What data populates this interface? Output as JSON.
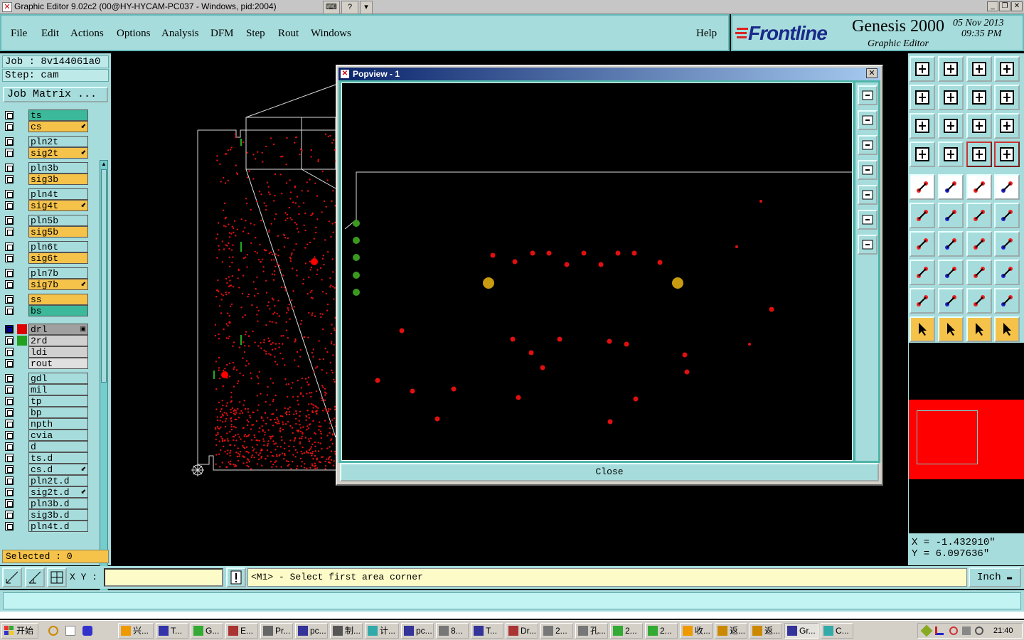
{
  "titlebar": {
    "title": "Graphic Editor 9.02c2 (00@HY-HYCAM-PC037 - Windows, pid:2004)",
    "mid_buttons": [
      "keyboard-icon",
      "help-icon",
      "menu-arrow-icon"
    ],
    "window_buttons": [
      "minimize",
      "restore",
      "close"
    ]
  },
  "menu": {
    "items": [
      "File",
      "Edit",
      "Actions",
      "Options",
      "Analysis",
      "DFM",
      "Step",
      "Rout",
      "Windows"
    ],
    "help": "Help"
  },
  "brand": {
    "logo": "Frontline",
    "product": "Genesis 2000",
    "subtitle": "Graphic Editor",
    "date": "05 Nov 2013",
    "time": "09:35 PM"
  },
  "job": {
    "job_label": "Job : 8v144061a0",
    "step_label": "Step: cam",
    "matrix_button": "Job Matrix ..."
  },
  "layers": [
    {
      "name": "ts",
      "color": "#3cb89a",
      "group": 1
    },
    {
      "name": "cs",
      "color": "#f5c24a",
      "group": 1,
      "flag": "arrow"
    },
    {
      "name": "pln2t",
      "color": "#a7dcdc",
      "group": 1
    },
    {
      "name": "sig2t",
      "color": "#f5c24a",
      "group": 1,
      "flag": "arrow"
    },
    {
      "name": "pln3b",
      "color": "#a7dcdc",
      "group": 1
    },
    {
      "name": "sig3b",
      "color": "#f5c24a",
      "group": 1
    },
    {
      "name": "pln4t",
      "color": "#a7dcdc",
      "group": 1
    },
    {
      "name": "sig4t",
      "color": "#f5c24a",
      "group": 1,
      "flag": "arrow"
    },
    {
      "name": "pln5b",
      "color": "#a7dcdc",
      "group": 1
    },
    {
      "name": "sig5b",
      "color": "#f5c24a",
      "group": 1
    },
    {
      "name": "pln6t",
      "color": "#a7dcdc",
      "group": 1
    },
    {
      "name": "sig6t",
      "color": "#f5c24a",
      "group": 1
    },
    {
      "name": "pln7b",
      "color": "#a7dcdc",
      "group": 1
    },
    {
      "name": "sig7b",
      "color": "#f5c24a",
      "group": 1,
      "flag": "arrow"
    },
    {
      "name": "ss",
      "color": "#f5c24a",
      "group": 1
    },
    {
      "name": "bs",
      "color": "#3cb89a",
      "group": 1
    },
    {
      "name": "drl",
      "color": "#a0a0a0",
      "group": 2,
      "swatch": "#e00000",
      "active": true,
      "flag": "box"
    },
    {
      "name": "2rd",
      "color": "#d0d0d0",
      "group": 2,
      "swatch": "#22a020"
    },
    {
      "name": "ldi",
      "color": "#d0d0d0",
      "group": 2
    },
    {
      "name": "rout",
      "color": "#e0e0e0",
      "group": 2
    },
    {
      "name": "gdl",
      "color": "#a7dcdc",
      "group": 3
    },
    {
      "name": "mil",
      "color": "#a7dcdc",
      "group": 3
    },
    {
      "name": "tp",
      "color": "#a7dcdc",
      "group": 3
    },
    {
      "name": "bp",
      "color": "#a7dcdc",
      "group": 3
    },
    {
      "name": "npth",
      "color": "#a7dcdc",
      "group": 3
    },
    {
      "name": "cvia",
      "color": "#a7dcdc",
      "group": 3
    },
    {
      "name": "d",
      "color": "#a7dcdc",
      "group": 3
    },
    {
      "name": "ts.d",
      "color": "#a7dcdc",
      "group": 3
    },
    {
      "name": "cs.d",
      "color": "#a7dcdc",
      "group": 3,
      "flag": "arrow"
    },
    {
      "name": "pln2t.d",
      "color": "#a7dcdc",
      "group": 3
    },
    {
      "name": "sig2t.d",
      "color": "#a7dcdc",
      "group": 3,
      "flag": "arrow"
    },
    {
      "name": "pln3b.d",
      "color": "#a7dcdc",
      "group": 3
    },
    {
      "name": "sig3b.d",
      "color": "#a7dcdc",
      "group": 3
    },
    {
      "name": "pln4t.d",
      "color": "#a7dcdc",
      "group": 3
    }
  ],
  "selected": "Selected : 0",
  "popview": {
    "title": "Popview - 1",
    "close_label": "Close",
    "tools": [
      "zoom-window-icon",
      "pan-up-icon",
      "pan-down-icon",
      "pan-left-icon",
      "pan-right-icon",
      "zoom-in-icon",
      "zoom-out-icon"
    ]
  },
  "right_tools": [
    "zoom-home-icon",
    "zoom-previous-icon",
    "zoom-reset-icon",
    "zoom-area-icon",
    "pan-left-tool-icon",
    "pan-right-tool-icon",
    "undo-pan-icon",
    "snake-icon",
    "fit-icon",
    "center-icon",
    "scale-icon",
    "query-icon",
    "layer-settings-icon",
    "grid-icon",
    "connect-red-icon",
    "connect-red2-icon",
    "pad-select-icon",
    "line-select-icon",
    "measure-icon",
    "circle-select-icon",
    "node-icon",
    "cross-icon",
    "point-icon",
    "point-red-icon",
    "angle-icon",
    "slash-icon",
    "arc-icon",
    "feature-icon",
    "square-dot-icon",
    "line-icon",
    "stretch-icon",
    "join-icon",
    "triangle-icon",
    "triangle2-icon",
    "triangle3-icon",
    "triangle4-icon",
    "pointer-icon",
    "pointer-box-icon",
    "pointer-circle-icon",
    "path-icon"
  ],
  "coords": {
    "x": "X = -1.432910\"",
    "y": "Y = 6.097636\""
  },
  "command": {
    "xy_label": "X Y :",
    "xy_value": "",
    "prompt": "<M1> - Select first area corner",
    "unit": "Inch"
  },
  "taskbar": {
    "start": "开始",
    "tasks": [
      "兴...",
      "T...",
      "G...",
      "E...",
      "Pr...",
      "pc...",
      "制...",
      "计...",
      "pc...",
      "8...",
      "T...",
      "Dr...",
      "2...",
      "孔...",
      "2...",
      "2...",
      "收...",
      "返...",
      "返...",
      "Gr...",
      "C..."
    ],
    "clock": "21:40"
  }
}
